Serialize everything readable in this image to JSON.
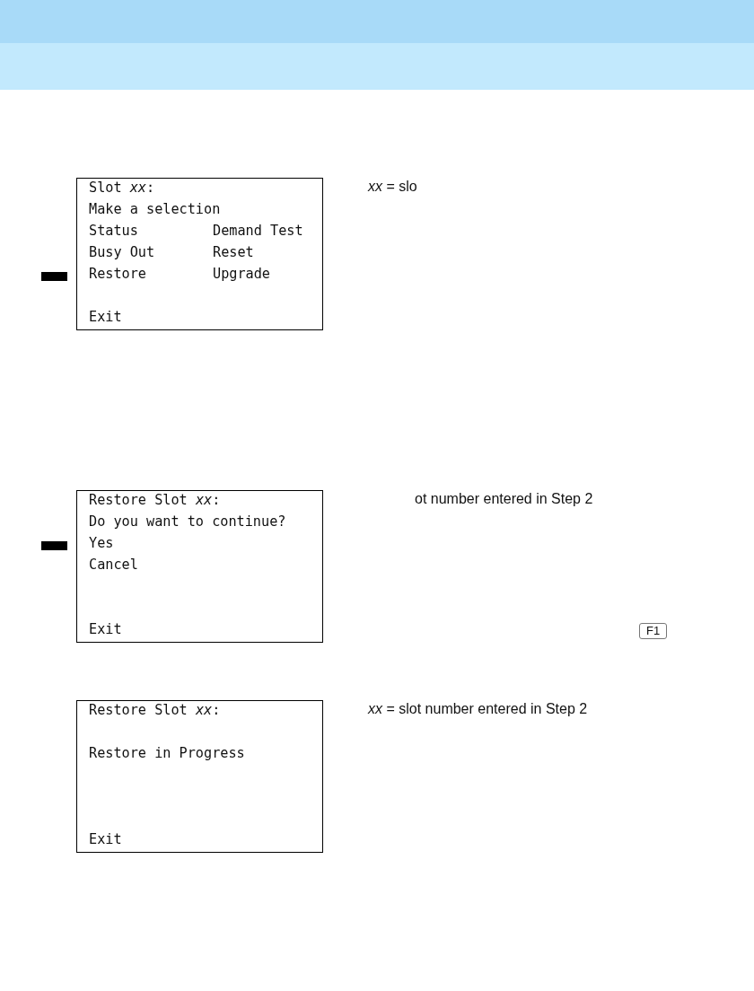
{
  "screens": [
    {
      "lines": [
        {
          "kind": "text",
          "cells": [
            "Slot *xx*:"
          ],
          "selected": false
        },
        {
          "kind": "text",
          "cells": [
            "Make a selection"
          ],
          "selected": false
        },
        {
          "kind": "text",
          "cells": [
            "Status",
            "Demand Test"
          ],
          "selected": false
        },
        {
          "kind": "text",
          "cells": [
            "Busy Out",
            "Reset"
          ],
          "selected": false
        },
        {
          "kind": "text",
          "cells": [
            "Restore",
            "Upgrade"
          ],
          "selected": true
        },
        {
          "kind": "blank",
          "selected": false
        },
        {
          "kind": "text",
          "cells": [
            "Exit"
          ],
          "selected": false
        }
      ],
      "note": "*xx* = slo"
    },
    {
      "lines": [
        {
          "kind": "text",
          "cells": [
            "Restore Slot *xx*:"
          ],
          "selected": false
        },
        {
          "kind": "text",
          "cells": [
            "Do you want to continue?"
          ],
          "selected": false
        },
        {
          "kind": "text",
          "cells": [
            "Yes"
          ],
          "selected": true
        },
        {
          "kind": "text",
          "cells": [
            "Cancel"
          ],
          "selected": false
        },
        {
          "kind": "blank",
          "selected": false
        },
        {
          "kind": "blank",
          "selected": false
        },
        {
          "kind": "text",
          "cells": [
            "Exit"
          ],
          "selected": false
        }
      ],
      "note": "ot number entered in Step 2",
      "key": "F1"
    },
    {
      "lines": [
        {
          "kind": "text",
          "cells": [
            "Restore Slot *xx*:"
          ],
          "selected": false
        },
        {
          "kind": "blank",
          "selected": false
        },
        {
          "kind": "text",
          "cells": [
            "Restore in Progress"
          ],
          "selected": false
        },
        {
          "kind": "blank",
          "selected": false
        },
        {
          "kind": "blank",
          "selected": false
        },
        {
          "kind": "blank",
          "selected": false
        },
        {
          "kind": "text",
          "cells": [
            "Exit"
          ],
          "selected": false
        }
      ],
      "note": "*xx* = slot number entered in Step 2"
    }
  ]
}
